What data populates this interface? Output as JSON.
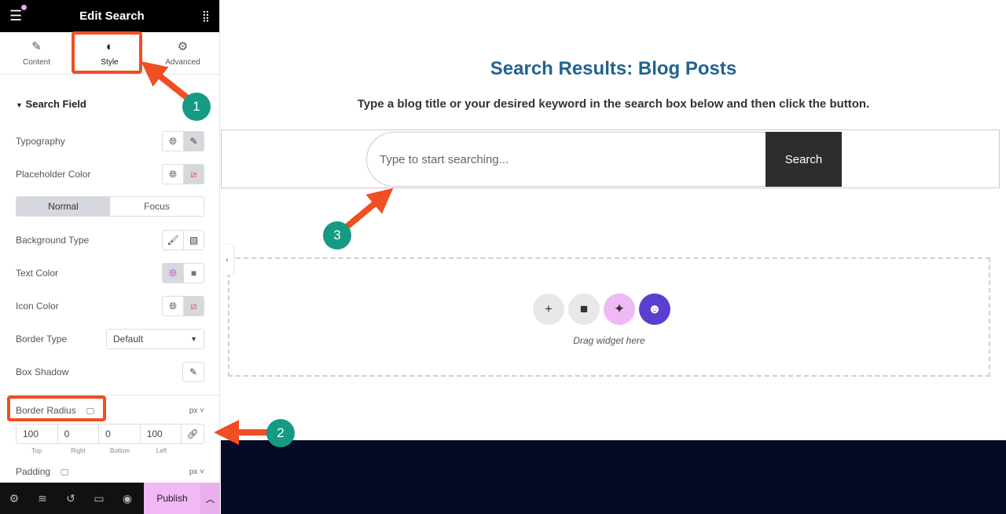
{
  "panel": {
    "title": "Edit Search",
    "tabs": [
      {
        "label": "Content",
        "icon": "pencil-icon"
      },
      {
        "label": "Style",
        "icon": "half-circle-icon",
        "active": true
      },
      {
        "label": "Advanced",
        "icon": "gear-icon"
      }
    ],
    "section": "Search Field",
    "rows": {
      "typography": "Typography",
      "placeholder_color": "Placeholder Color",
      "background_type": "Background Type",
      "text_color": "Text Color",
      "icon_color": "Icon Color",
      "border_type": "Border Type",
      "box_shadow": "Box Shadow"
    },
    "state_tabs": [
      "Normal",
      "Focus"
    ],
    "border_type_value": "Default",
    "border_radius": {
      "label": "Border Radius",
      "unit": "px",
      "values": [
        "100",
        "0",
        "0",
        "100"
      ],
      "labels": [
        "Top",
        "Right",
        "Bottom",
        "Left"
      ]
    },
    "padding": {
      "label": "Padding",
      "unit": "px"
    },
    "publish": "Publish"
  },
  "canvas": {
    "title": "Search Results: Blog Posts",
    "subtitle": "Type a blog title or your desired keyword in the search box below and then click the button.",
    "search_placeholder": "Type to start searching...",
    "search_button": "Search",
    "drag_text": "Drag widget here"
  },
  "annotations": [
    "1",
    "2",
    "3"
  ],
  "colors": {
    "accent": "#f0b8f4",
    "title": "#22638f",
    "annotation_red": "#f04e23",
    "annotation_green": "#159a83",
    "footer": "#070a24"
  }
}
